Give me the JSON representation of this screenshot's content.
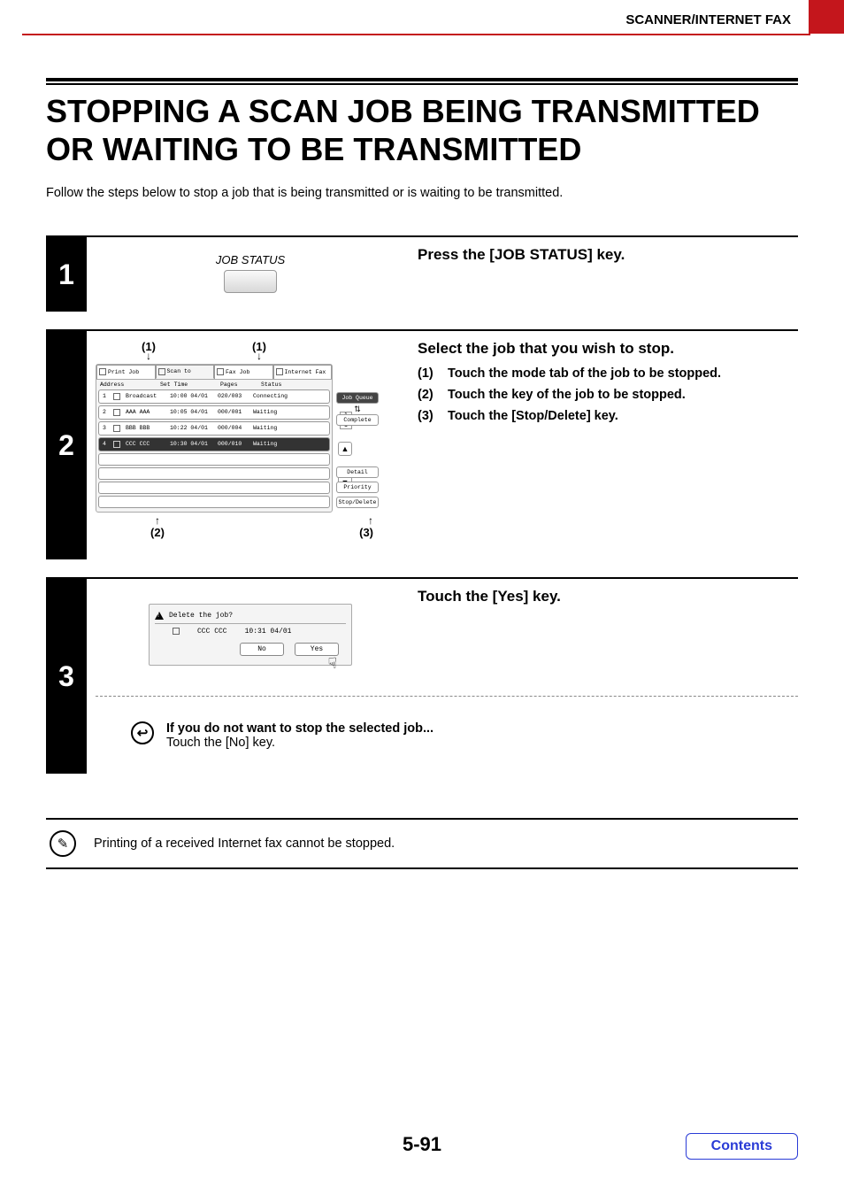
{
  "header": {
    "chapter": "SCANNER/INTERNET FAX"
  },
  "topic": {
    "title": "STOPPING A SCAN JOB BEING TRANSMITTED OR WAITING TO BE TRANSMITTED",
    "intro": "Follow the steps below to stop a job that is being transmitted or is waiting to be transmitted."
  },
  "step1": {
    "num": "1",
    "heading": "Press the [JOB STATUS] key.",
    "fig_label": "JOB STATUS"
  },
  "step2": {
    "num": "2",
    "heading": "Select the job that you wish to stop.",
    "subs": [
      {
        "n": "(1)",
        "t": "Touch the mode tab of the job to be stopped."
      },
      {
        "n": "(2)",
        "t": "Touch the key of the job to be stopped."
      },
      {
        "n": "(3)",
        "t": "Touch the [Stop/Delete] key."
      }
    ],
    "callouts": {
      "c1a": "(1)",
      "c1b": "(1)",
      "c2": "(2)",
      "c3": "(3)"
    },
    "panel": {
      "tabs": [
        "Print Job",
        "Scan to",
        "Fax Job",
        "Internet Fax"
      ],
      "headers": {
        "addr": "Address",
        "time": "Set Time",
        "pages": "Pages",
        "status": "Status"
      },
      "rows": [
        {
          "n": "1",
          "addr": "Broadcast",
          "time": "10:00 04/01",
          "pages": "020/003",
          "status": "Connecting",
          "sel": false
        },
        {
          "n": "2",
          "addr": "AAA AAA",
          "time": "10:05 04/01",
          "pages": "000/001",
          "status": "Waiting",
          "sel": false
        },
        {
          "n": "3",
          "addr": "BBB BBB",
          "time": "10:22 04/01",
          "pages": "000/004",
          "status": "Waiting",
          "sel": false
        },
        {
          "n": "4",
          "addr": "CCC CCC",
          "time": "10:30 04/01",
          "pages": "000/010",
          "status": "Waiting",
          "sel": true
        }
      ],
      "side": {
        "queue": "Job Queue",
        "complete": "Complete",
        "detail": "Detail",
        "priority": "Priority",
        "stop": "Stop/Delete"
      },
      "page": {
        "cur": "1",
        "tot": "1"
      },
      "scroll": {
        "up": "▲",
        "down": "▼"
      }
    }
  },
  "step3": {
    "num": "3",
    "heading": "Touch the [Yes] key.",
    "dialog": {
      "title": "Delete the job?",
      "job": "CCC CCC",
      "time": "10:31 04/01",
      "no": "No",
      "yes": "Yes"
    },
    "note_bold": "If you do not want to stop the selected job...",
    "note_text": "Touch the [No] key."
  },
  "info": {
    "text": "Printing of a received Internet fax cannot be stopped."
  },
  "footer": {
    "page": "5-91",
    "contents": "Contents"
  }
}
